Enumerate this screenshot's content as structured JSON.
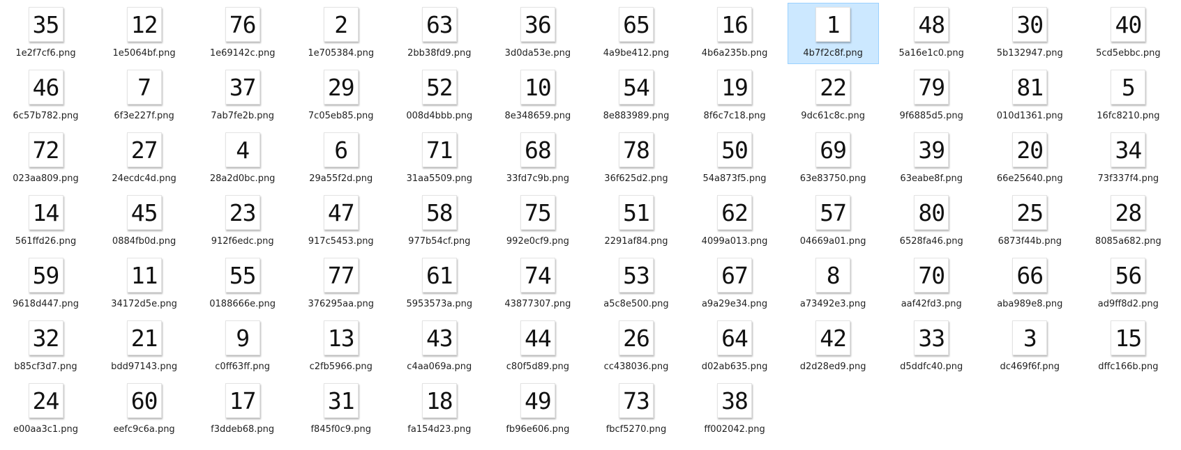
{
  "selection_color": "#cce8ff",
  "files": [
    {
      "name": "1e2f7cf6.png",
      "number": "35"
    },
    {
      "name": "1e5064bf.png",
      "number": "12"
    },
    {
      "name": "1e69142c.png",
      "number": "76"
    },
    {
      "name": "1e705384.png",
      "number": "2"
    },
    {
      "name": "2bb38fd9.png",
      "number": "63"
    },
    {
      "name": "3d0da53e.png",
      "number": "36"
    },
    {
      "name": "4a9be412.png",
      "number": "65"
    },
    {
      "name": "4b6a235b.png",
      "number": "16"
    },
    {
      "name": "4b7f2c8f.png",
      "number": "1",
      "selected": true
    },
    {
      "name": "5a16e1c0.png",
      "number": "48"
    },
    {
      "name": "5b132947.png",
      "number": "30"
    },
    {
      "name": "5cd5ebbc.png",
      "number": "40"
    },
    {
      "name": "6c57b782.png",
      "number": "46"
    },
    {
      "name": "6f3e227f.png",
      "number": "7"
    },
    {
      "name": "7ab7fe2b.png",
      "number": "37"
    },
    {
      "name": "7c05eb85.png",
      "number": "29"
    },
    {
      "name": "008d4bbb.png",
      "number": "52"
    },
    {
      "name": "8e348659.png",
      "number": "10"
    },
    {
      "name": "8e883989.png",
      "number": "54"
    },
    {
      "name": "8f6c7c18.png",
      "number": "19"
    },
    {
      "name": "9dc61c8c.png",
      "number": "22"
    },
    {
      "name": "9f6885d5.png",
      "number": "79"
    },
    {
      "name": "010d1361.png",
      "number": "81"
    },
    {
      "name": "16fc8210.png",
      "number": "5"
    },
    {
      "name": "023aa809.png",
      "number": "72"
    },
    {
      "name": "24ecdc4d.png",
      "number": "27"
    },
    {
      "name": "28a2d0bc.png",
      "number": "4"
    },
    {
      "name": "29a55f2d.png",
      "number": "6"
    },
    {
      "name": "31aa5509.png",
      "number": "71"
    },
    {
      "name": "33fd7c9b.png",
      "number": "68"
    },
    {
      "name": "36f625d2.png",
      "number": "78"
    },
    {
      "name": "54a873f5.png",
      "number": "50"
    },
    {
      "name": "63e83750.png",
      "number": "69"
    },
    {
      "name": "63eabe8f.png",
      "number": "39"
    },
    {
      "name": "66e25640.png",
      "number": "20"
    },
    {
      "name": "73f337f4.png",
      "number": "34"
    },
    {
      "name": "561ffd26.png",
      "number": "14"
    },
    {
      "name": "0884fb0d.png",
      "number": "45"
    },
    {
      "name": "912f6edc.png",
      "number": "23"
    },
    {
      "name": "917c5453.png",
      "number": "47"
    },
    {
      "name": "977b54cf.png",
      "number": "58"
    },
    {
      "name": "992e0cf9.png",
      "number": "75"
    },
    {
      "name": "2291af84.png",
      "number": "51"
    },
    {
      "name": "4099a013.png",
      "number": "62"
    },
    {
      "name": "04669a01.png",
      "number": "57"
    },
    {
      "name": "6528fa46.png",
      "number": "80"
    },
    {
      "name": "6873f44b.png",
      "number": "25"
    },
    {
      "name": "8085a682.png",
      "number": "28"
    },
    {
      "name": "9618d447.png",
      "number": "59"
    },
    {
      "name": "34172d5e.png",
      "number": "11"
    },
    {
      "name": "0188666e.png",
      "number": "55"
    },
    {
      "name": "376295aa.png",
      "number": "77"
    },
    {
      "name": "5953573a.png",
      "number": "61"
    },
    {
      "name": "43877307.png",
      "number": "74"
    },
    {
      "name": "a5c8e500.png",
      "number": "53"
    },
    {
      "name": "a9a29e34.png",
      "number": "67"
    },
    {
      "name": "a73492e3.png",
      "number": "8"
    },
    {
      "name": "aaf42fd3.png",
      "number": "70"
    },
    {
      "name": "aba989e8.png",
      "number": "66"
    },
    {
      "name": "ad9ff8d2.png",
      "number": "56"
    },
    {
      "name": "b85cf3d7.png",
      "number": "32"
    },
    {
      "name": "bdd97143.png",
      "number": "21"
    },
    {
      "name": "c0ff63ff.png",
      "number": "9"
    },
    {
      "name": "c2fb5966.png",
      "number": "13"
    },
    {
      "name": "c4aa069a.png",
      "number": "43"
    },
    {
      "name": "c80f5d89.png",
      "number": "44"
    },
    {
      "name": "cc438036.png",
      "number": "26"
    },
    {
      "name": "d02ab635.png",
      "number": "64"
    },
    {
      "name": "d2d28ed9.png",
      "number": "42"
    },
    {
      "name": "d5ddfc40.png",
      "number": "33"
    },
    {
      "name": "dc469f6f.png",
      "number": "3"
    },
    {
      "name": "dffc166b.png",
      "number": "15"
    },
    {
      "name": "e00aa3c1.png",
      "number": "24"
    },
    {
      "name": "eefc9c6a.png",
      "number": "60"
    },
    {
      "name": "f3ddeb68.png",
      "number": "17"
    },
    {
      "name": "f845f0c9.png",
      "number": "31"
    },
    {
      "name": "fa154d23.png",
      "number": "18"
    },
    {
      "name": "fb96e606.png",
      "number": "49"
    },
    {
      "name": "fbcf5270.png",
      "number": "73"
    },
    {
      "name": "ff002042.png",
      "number": "38"
    }
  ]
}
